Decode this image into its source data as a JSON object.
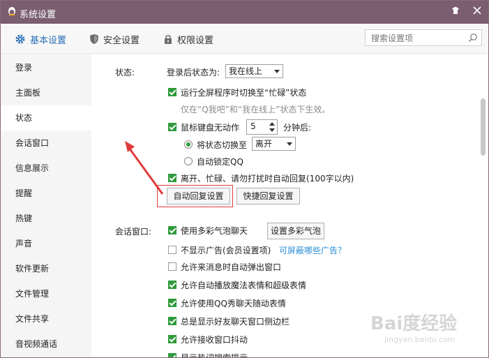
{
  "window": {
    "title": "系统设置",
    "colors": {
      "titlebar": "#7b5e70",
      "accent": "#2b6fb6",
      "check": "#2f9b3b",
      "link": "#2b8fd6",
      "highlight": "#e23a3a"
    }
  },
  "tabs": [
    {
      "label": "基本设置",
      "icon": "gear-icon"
    },
    {
      "label": "安全设置",
      "icon": "shield-icon"
    },
    {
      "label": "权限设置",
      "icon": "lock-icon"
    }
  ],
  "search": {
    "placeholder": "搜索设置项"
  },
  "sidebar": {
    "items": [
      "登录",
      "主面板",
      "状态",
      "会话窗口",
      "信息展示",
      "提醒",
      "热键",
      "声音",
      "软件更新",
      "文件管理",
      "文件共享",
      "音视频通话"
    ],
    "active": "状态"
  },
  "status_section": {
    "label": "状态:",
    "login_status_label": "登录后状态为:",
    "login_status_value": "我在线上",
    "fullscreen_busy": "运行全屏程序时切换至“忙碌”状态",
    "fullscreen_note": "仅在“Q我吧”和“我在线上”状态下生效。",
    "idle_prefix": "鼠标键盘无动作",
    "idle_minutes": "5",
    "idle_suffix": "分钟后:",
    "switch_status_label": "将状态切换至",
    "switch_status_value": "离开",
    "auto_lock": "自动锁定QQ",
    "auto_reply": "离开、忙碌、请勿打扰时自动回复(100字以内)",
    "auto_reply_button": "自动回复设置",
    "quick_reply_button": "快捷回复设置"
  },
  "chat_section": {
    "label": "会话窗口:",
    "options": [
      {
        "text": "使用多彩气泡聊天",
        "checked": true
      },
      {
        "text": "不显示广告(会员设置项)",
        "checked": false
      },
      {
        "text": "允许来消息时自动弹出窗口",
        "checked": false
      },
      {
        "text": "允许自动播放魔法表情和超级表情",
        "checked": true
      },
      {
        "text": "允许使用QQ秀聊天随动表情",
        "checked": true
      },
      {
        "text": "总是显示好友聊天窗口侧边栏",
        "checked": true
      },
      {
        "text": "允许接收窗口抖动",
        "checked": true
      },
      {
        "text": "显示热词搜索提示",
        "checked": true
      }
    ],
    "bubble_button": "设置多彩气泡",
    "ad_link": "可屏蔽哪些广告？"
  },
  "watermark": {
    "text": "Bai度经验",
    "sub": "jingyan.baidu.com"
  }
}
